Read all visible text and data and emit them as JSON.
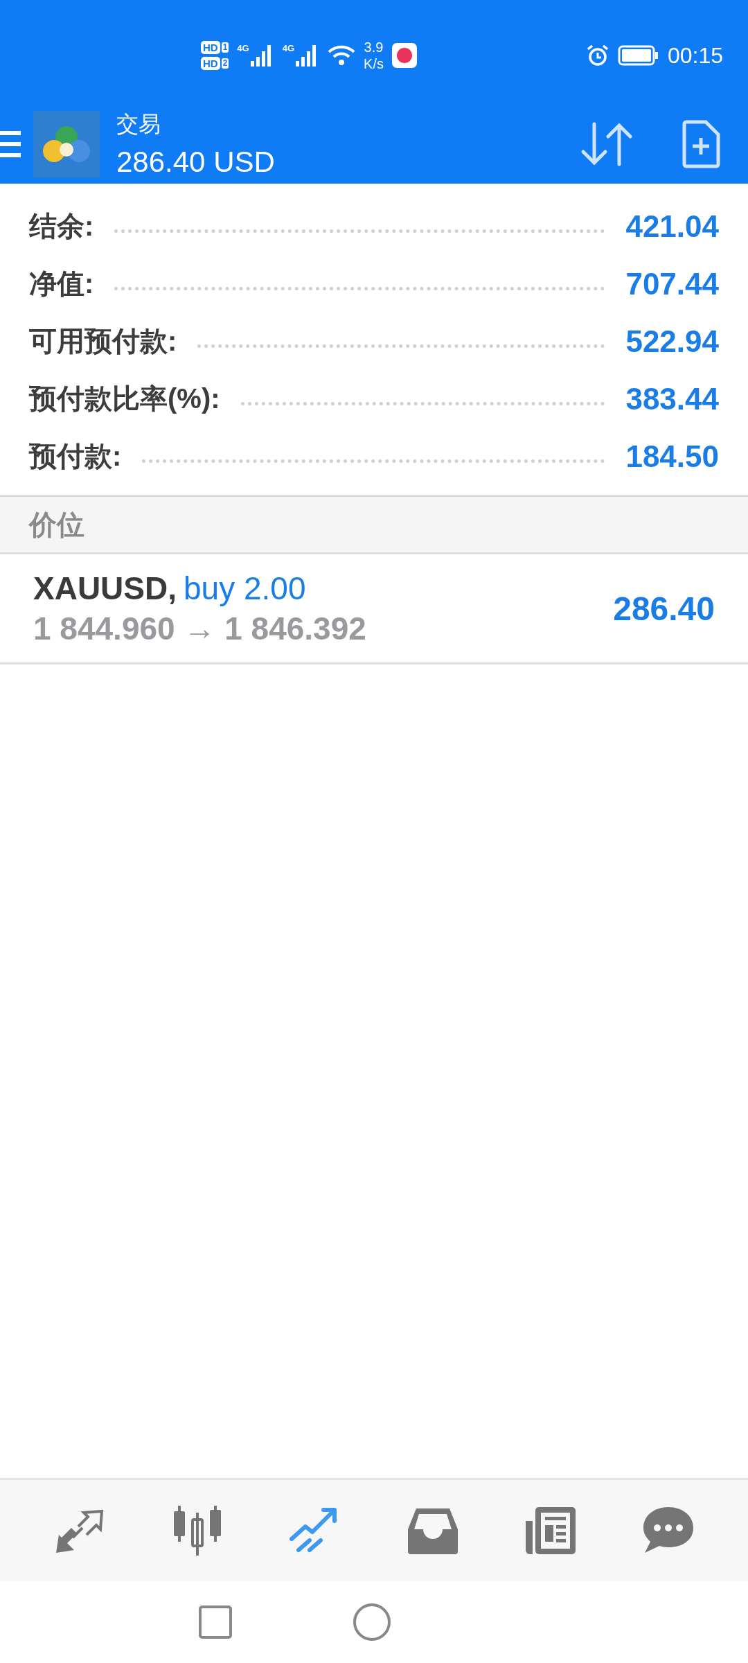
{
  "status_bar": {
    "sims": [
      {
        "label": "HD",
        "slot": "1"
      },
      {
        "label": "HD",
        "slot": "2"
      }
    ],
    "signals": [
      {
        "label": "4G"
      },
      {
        "label": "4G"
      }
    ],
    "speed": [
      "3.9",
      "K/s"
    ],
    "time": "00:15"
  },
  "toolbar": {
    "title": "交易",
    "balance": "286.40 USD"
  },
  "summary": [
    {
      "label": "结余:",
      "value": "421.04"
    },
    {
      "label": "净值:",
      "value": "707.44"
    },
    {
      "label": "可用预付款:",
      "value": "522.94"
    },
    {
      "label": "预付款比率(%):",
      "value": "383.44"
    },
    {
      "label": "预付款:",
      "value": "184.50"
    }
  ],
  "section_header": "价位",
  "positions": [
    {
      "symbol": "XAUUSD,",
      "order": "buy 2.00",
      "prices": "1 844.960 → 1 846.392",
      "profit": "286.40"
    }
  ],
  "bottom_nav": [
    {
      "kind": "quotes",
      "selected": false
    },
    {
      "kind": "chart",
      "selected": false
    },
    {
      "kind": "trade",
      "selected": true
    },
    {
      "kind": "history",
      "selected": false
    },
    {
      "kind": "news",
      "selected": false
    },
    {
      "kind": "chat",
      "selected": false
    }
  ]
}
